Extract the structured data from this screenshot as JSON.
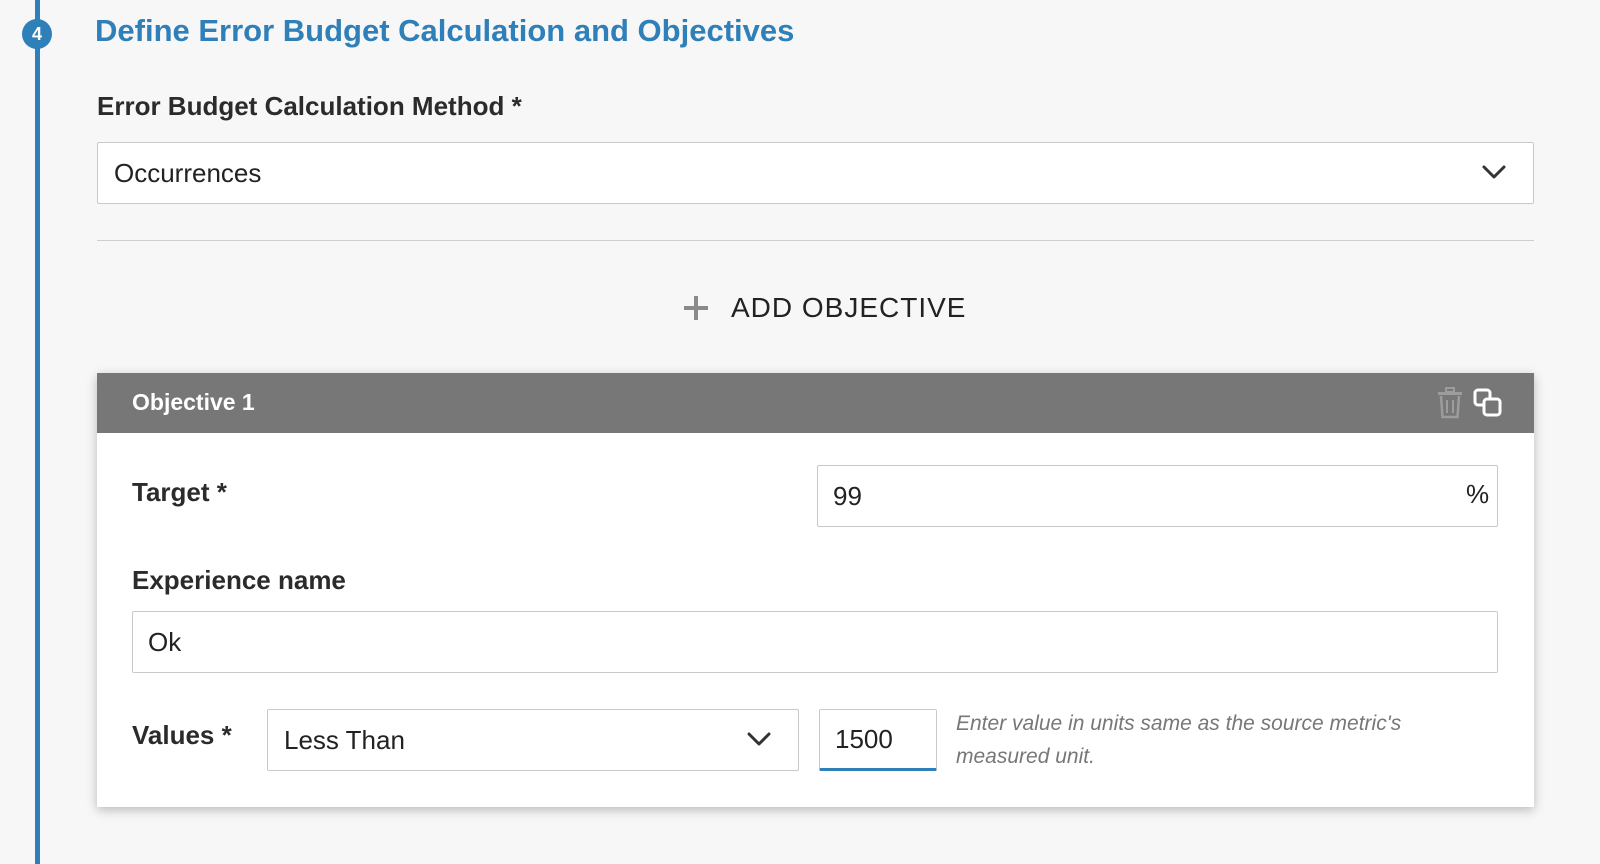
{
  "step": {
    "number": "4",
    "title": "Define Error Budget Calculation and Objectives"
  },
  "error_budget": {
    "label": "Error Budget Calculation Method *",
    "selected": "Occurrences"
  },
  "add_objective": {
    "label": "ADD OBJECTIVE"
  },
  "objective": {
    "title": "Objective 1",
    "target": {
      "label": "Target *",
      "value": "99",
      "suffix": "%"
    },
    "experience": {
      "label": "Experience name",
      "value": "Ok"
    },
    "values": {
      "label": "Values *",
      "operator": "Less Than",
      "threshold": "1500",
      "helper": "Enter value in units same as the source metric's measured unit."
    }
  },
  "colors": {
    "accent": "#2f7fb8",
    "header_bg": "#777777",
    "page_bg": "#f7f7f7"
  },
  "icons": {
    "plus": "plus-icon",
    "chevron": "chevron-down-icon",
    "trash": "trash-icon",
    "copy": "copy-icon"
  }
}
